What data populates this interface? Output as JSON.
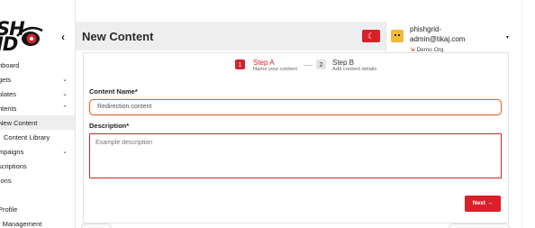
{
  "app": {
    "logo_text": "SH\nID"
  },
  "sidebar": {
    "collapse_icon": "‹",
    "items": [
      {
        "label": "hboard",
        "chevron": ""
      },
      {
        "label": "gets",
        "chevron": "⌄"
      },
      {
        "label": "plates",
        "chevron": "⌄"
      },
      {
        "label": "ntents",
        "chevron": "⌃"
      },
      {
        "label": "New Content",
        "chevron": "",
        "active": true
      },
      {
        "label": "Content Library",
        "chevron": ""
      },
      {
        "label": "mpaigns",
        "chevron": "⌄"
      },
      {
        "label": "scriptions",
        "chevron": ""
      },
      {
        "label": "-ons",
        "chevron": ""
      },
      {
        "label": "",
        "chevron": ""
      },
      {
        "label": "Profile",
        "chevron": ""
      },
      {
        "label": "r Management",
        "chevron": ""
      }
    ]
  },
  "header": {
    "title": "New Content",
    "theme_icon": "☾"
  },
  "user": {
    "name": "phishgrid-admin@tikaj.com",
    "org_icon": "⇲",
    "org": "Demo Org",
    "caret": "▾"
  },
  "stepper": {
    "step_a": {
      "number": "1",
      "title": "Step A",
      "subtitle": "Name your content"
    },
    "step_b": {
      "number": "2",
      "title": "Step B",
      "subtitle": "Add content details"
    }
  },
  "form": {
    "name_label": "Content Name*",
    "name_value": "Redirection content",
    "desc_label": "Description*",
    "desc_placeholder": "Example description",
    "next_label": "Next →"
  },
  "colors": {
    "accent": "#d9202a",
    "focus_border": "#e2672f",
    "header_bg": "#eeeeee"
  }
}
